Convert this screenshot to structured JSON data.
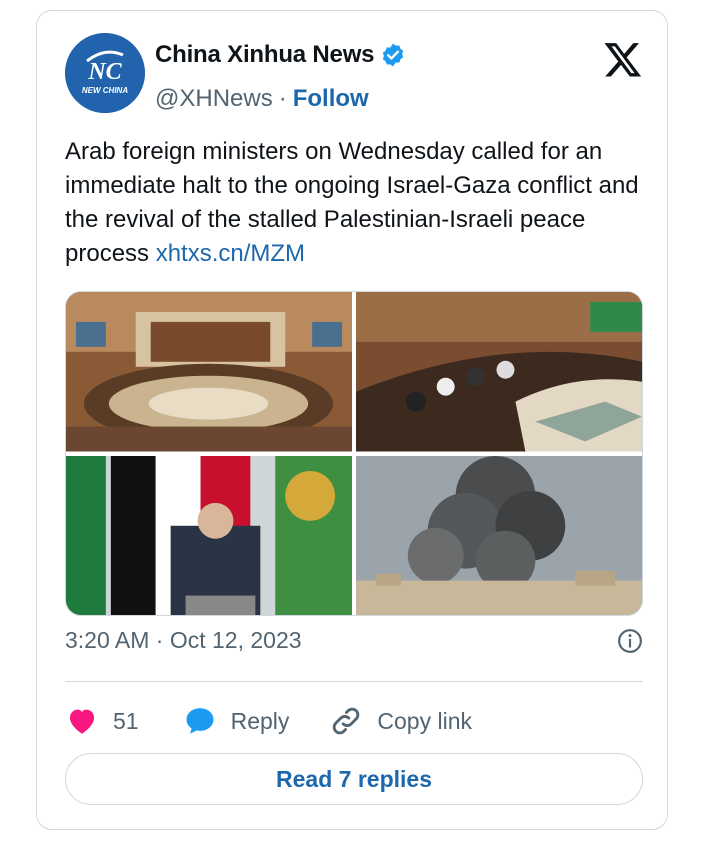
{
  "account": {
    "display_name": "China Xinhua News",
    "handle": "@XHNews",
    "separator": "·",
    "follow_label": "Follow",
    "avatar_logo_text": "NC",
    "avatar_caption": "NEW CHINA"
  },
  "tweet": {
    "text": "Arab foreign ministers on Wednesday called for an immediate halt to the ongoing Israel-Gaza conflict and the revival of the stalled Palestinian-Israeli peace process ",
    "link_text": "xhtxs.cn/MZM",
    "timestamp": "3:20 AM · Oct 12, 2023"
  },
  "actions": {
    "like_count": "51",
    "reply_label": "Reply",
    "copy_link_label": "Copy link",
    "read_replies_label": "Read 7 replies"
  },
  "icons": {
    "brand": "x-logo-icon",
    "verified": "verified-badge-icon",
    "info": "info-icon",
    "like": "heart-icon",
    "reply": "speech-bubble-icon",
    "copy": "link-icon"
  },
  "colors": {
    "link": "#1d67ad",
    "verified": "#1d9bf0",
    "like": "#f91880",
    "border": "#cfd9de",
    "secondary_text": "#536471"
  }
}
